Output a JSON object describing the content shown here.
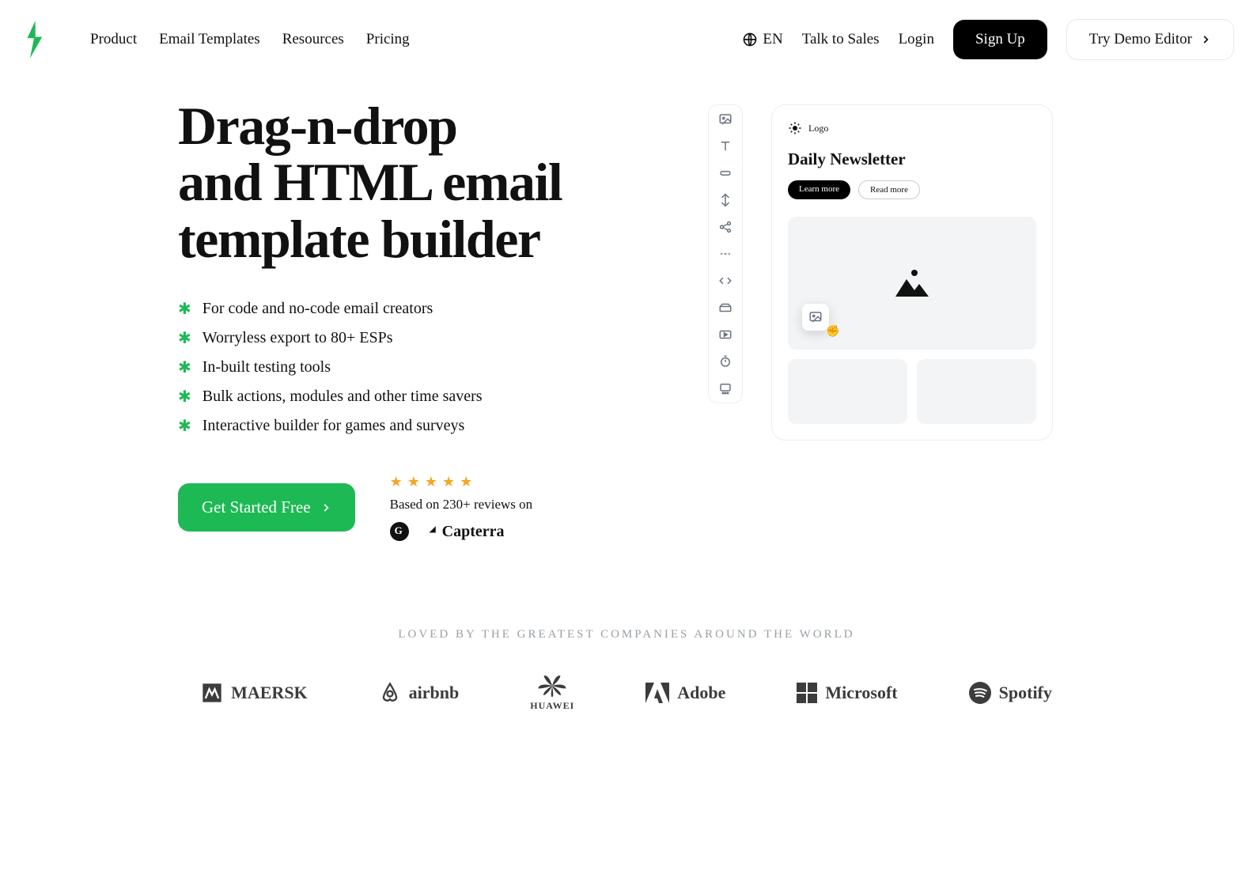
{
  "header": {
    "nav": [
      "Product",
      "Email Templates",
      "Resources",
      "Pricing"
    ],
    "lang": "EN",
    "talk": "Talk to Sales",
    "login": "Login",
    "signup": "Sign Up",
    "demo": "Try Demo Editor"
  },
  "hero": {
    "title_l1": "Drag-n-drop",
    "title_l2": "and HTML email",
    "title_l3": "template builder",
    "features": [
      "For code and no-code email creators",
      "Worryless export to 80+ ESPs",
      "In-built testing tools",
      "Bulk actions, modules and other time savers",
      "Interactive builder for games and surveys"
    ],
    "cta": "Get Started Free",
    "reviews_text": "Based on 230+ reviews on",
    "capterra": "Capterra"
  },
  "editor": {
    "rail_icons": [
      "image-icon",
      "text-icon",
      "button-icon",
      "spacer-icon",
      "social-icon",
      "divider-icon",
      "code-icon",
      "columns-icon",
      "video-icon",
      "timer-icon",
      "carousel-icon"
    ],
    "logo_label": "Logo",
    "canvas_title": "Daily Newsletter",
    "btn1": "Learn more",
    "btn2": "Read more"
  },
  "brands": {
    "title": "LOVED BY THE GREATEST COMPANIES AROUND THE WORLD",
    "list": [
      "MAERSK",
      "airbnb",
      "HUAWEI",
      "Adobe",
      "Microsoft",
      "Spotify"
    ]
  }
}
